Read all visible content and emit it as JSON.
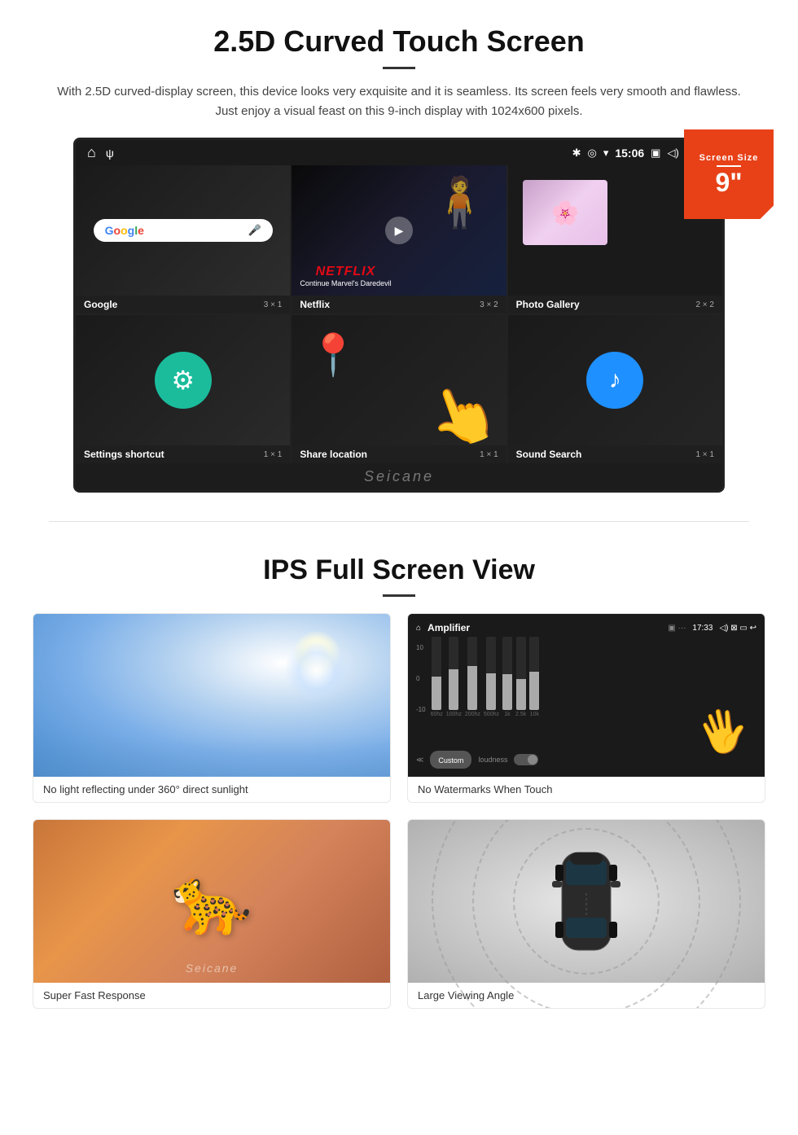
{
  "section1": {
    "title": "2.5D Curved Touch Screen",
    "description": "With 2.5D curved-display screen, this device looks very exquisite and it is seamless. Its screen feels very smooth and flawless. Just enjoy a visual feast on this 9-inch display with 1024x600 pixels.",
    "badge": {
      "label": "Screen Size",
      "size": "9\""
    },
    "statusBar": {
      "time": "15:06"
    },
    "apps": [
      {
        "name": "Google",
        "size": "3 × 1"
      },
      {
        "name": "Netflix",
        "size": "3 × 2"
      },
      {
        "name": "Photo Gallery",
        "size": "2 × 2"
      },
      {
        "name": "Settings shortcut",
        "size": "1 × 1"
      },
      {
        "name": "Share location",
        "size": "1 × 1"
      },
      {
        "name": "Sound Search",
        "size": "1 × 1"
      }
    ],
    "netflix": {
      "logo": "NETFLIX",
      "subtitle": "Continue Marvel's Daredevil"
    },
    "watermark": "Seicane"
  },
  "section2": {
    "title": "IPS Full Screen View",
    "features": [
      {
        "caption": "No light reflecting under 360° direct sunlight",
        "type": "sunlight"
      },
      {
        "caption": "No Watermarks When Touch",
        "type": "amplifier"
      },
      {
        "caption": "Super Fast Response",
        "type": "cheetah"
      },
      {
        "caption": "Large Viewing Angle",
        "type": "car"
      }
    ]
  }
}
